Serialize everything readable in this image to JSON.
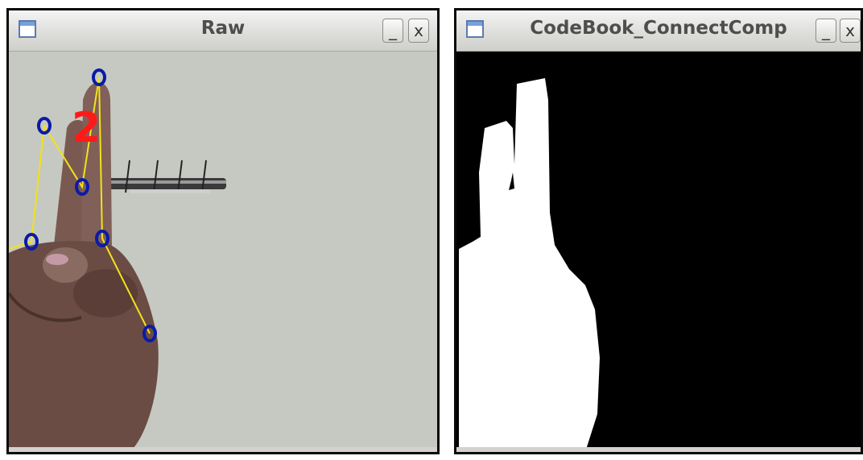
{
  "windows": {
    "raw": {
      "title": "Raw",
      "minimize_label": "_",
      "close_label": "x",
      "overlay_number": "2"
    },
    "codebook": {
      "title": "CodeBook_ConnectComp",
      "minimize_label": "_",
      "close_label": "x"
    }
  },
  "colors": {
    "marker": "#0b1aa8",
    "skeleton_line": "#f2e21a",
    "overlay_number": "#ff1a1a",
    "mask_foreground": "#ffffff",
    "mask_background": "#000000"
  },
  "icons": {
    "window_icon": "window-icon",
    "minimize": "minimize-icon",
    "close": "close-icon"
  }
}
